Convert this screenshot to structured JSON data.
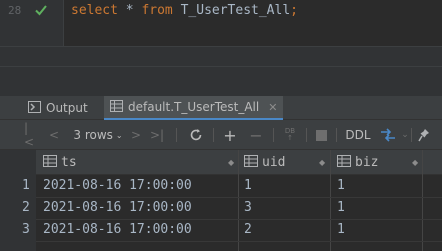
{
  "editor": {
    "line_number": "28",
    "keyword_select": "select",
    "star": " * ",
    "keyword_from": "from",
    "table_name": " T_UserTest_All",
    "semicolon": ";"
  },
  "tabs": {
    "output_label": "Output",
    "result_label": "default.T_UserTest_All"
  },
  "toolbar": {
    "rows_label": "3 rows",
    "ddl_label": "DDL"
  },
  "grid": {
    "columns": [
      "ts",
      "uid",
      "biz"
    ],
    "rows": [
      {
        "num": "1",
        "ts": "2021-08-16 17:00:00",
        "uid": "1",
        "biz": "1"
      },
      {
        "num": "2",
        "ts": "2021-08-16 17:00:00",
        "uid": "3",
        "biz": "1"
      },
      {
        "num": "3",
        "ts": "2021-08-16 17:00:00",
        "uid": "2",
        "biz": "1"
      }
    ]
  },
  "colors": {
    "keyword": "#cc7832",
    "identifier": "#a9b7c6",
    "check": "#5fb05f",
    "accent": "#4a88c7"
  }
}
